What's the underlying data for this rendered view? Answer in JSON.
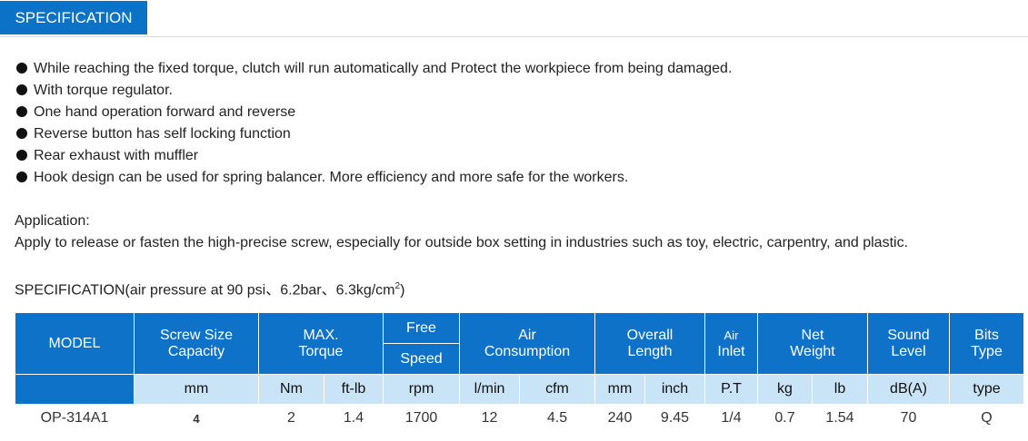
{
  "tab": {
    "label": "SPECIFICATION"
  },
  "features": [
    "While reaching the fixed torque, clutch will run automatically and Protect the workpiece from being damaged.",
    "With torque regulator.",
    "One hand operation forward and reverse",
    "Reverse button has self locking function",
    "Rear exhaust with muffler",
    "Hook design can be used for spring balancer. More efficiency and more safe for the workers."
  ],
  "application": {
    "title": "Application:",
    "text": "Apply to release or fasten the high-precise screw, especially for outside box setting in industries such as toy, electric, carpentry, and plastic."
  },
  "spec": {
    "title_main": "SPECIFICATION(air pressure at 90 psi、6.2bar、6.3kg/cm",
    "title_sup": "2",
    "title_end": ")"
  },
  "table": {
    "headers": {
      "model": "MODEL",
      "screw_1": "Screw Size",
      "screw_2": "Capacity",
      "torque_1": "MAX.",
      "torque_2": "Torque",
      "speed_1": "Free",
      "speed_2": "Speed",
      "air_1": "Air",
      "air_2": "Consumption",
      "length_1": "Overall",
      "length_2": "Length",
      "inlet_1": "Air",
      "inlet_2": "Inlet",
      "weight_1": "Net",
      "weight_2": "Weight",
      "sound_1": "Sound",
      "sound_2": "Level",
      "bits_1": "Bits",
      "bits_2": "Type"
    },
    "units": [
      "mm",
      "Nm",
      "ft-lb",
      "rpm",
      "l/min",
      "cfm",
      "mm",
      "inch",
      "P.T",
      "kg",
      "lb",
      "dB(A)",
      "type"
    ],
    "row": [
      "OP-314A1",
      "4",
      "2",
      "1.4",
      "1700",
      "12",
      "4.5",
      "240",
      "9.45",
      "1/4",
      "0.7",
      "1.54",
      "70",
      "Q"
    ]
  },
  "colors": {
    "accent": "#0d72c8",
    "unit_row": "#c9e3f7",
    "bits_type": "#e21f26"
  }
}
